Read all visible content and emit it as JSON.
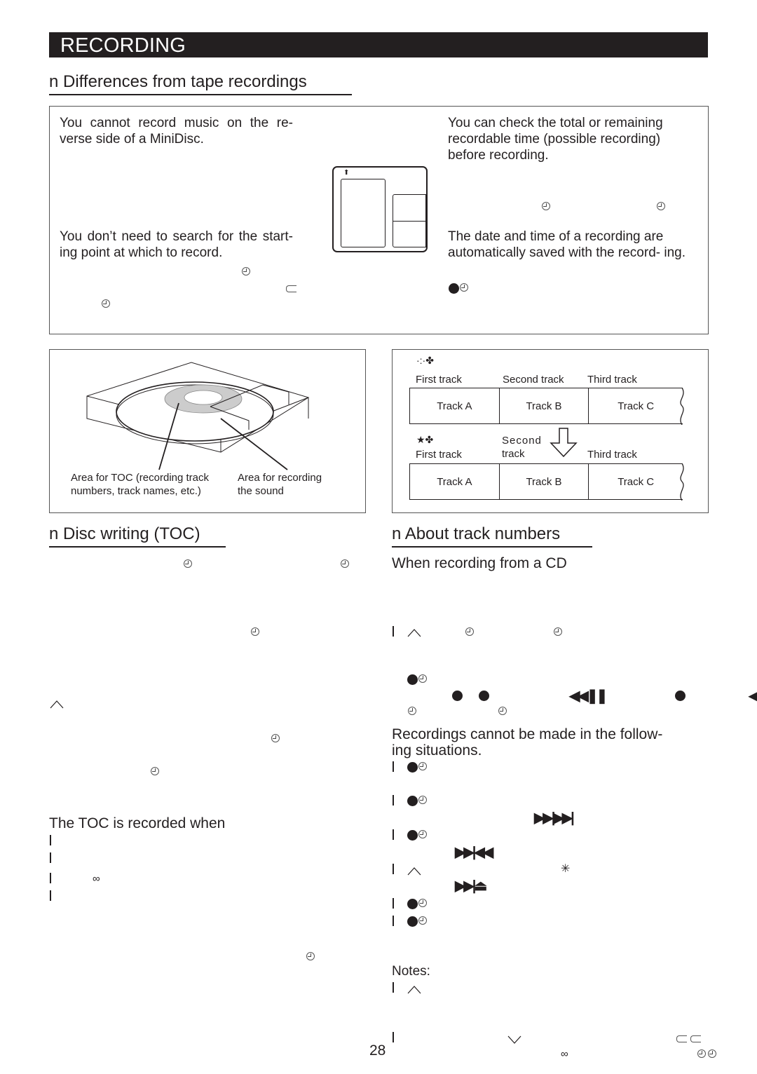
{
  "header": {
    "title": "RECORDING"
  },
  "sections": {
    "differences": {
      "heading": "n  Differences from tape recordings",
      "left": {
        "para1": "You cannot record music on the re- verse side of a MiniDisc.",
        "para2": "You don’t need to search for the start- ing point at which to record."
      },
      "right": {
        "para1": "You can check the total or remaining recordable time (possible recording) before recording.",
        "para2": "The date and time of a recording are automatically saved with the record- ing."
      }
    },
    "disc_diagram": {
      "label_toc": "Area for TOC (recording track numbers, track names, etc.)",
      "label_toc_line1": "Area for TOC (recording track",
      "label_toc_line2": "numbers, track names, etc.)",
      "label_sound_line1": "Area  for  recording",
      "label_sound_line2": "the sound"
    },
    "track_diagram": {
      "before": {
        "symbol": "·:·✤",
        "headers": [
          "First track",
          "Second track",
          "Third track"
        ],
        "cells": [
          "Track A",
          "Track B",
          "Track C"
        ]
      },
      "after": {
        "symbol": "★✤",
        "headers": [
          "First track",
          "Second",
          "track",
          "Third track"
        ],
        "cells": [
          "Track A",
          "Track B",
          "Track C"
        ]
      }
    },
    "toc": {
      "heading": "n  Disc writing (TOC)",
      "sub": "The TOC is recorded when"
    },
    "track_numbers": {
      "heading": "n  About track numbers",
      "sub1": "When recording from a CD",
      "sub2_line1": "Recordings cannot be made in the follow-",
      "sub2_line2": "ing situations.",
      "notes": "Notes:"
    }
  },
  "glyphs": {
    "skip_back_pause": "◀◀❚❚",
    "skip_fwd_skip_fwd": "▶▶|▶▶|",
    "skip_fwd_skip_back": "▶▶|◀◀",
    "skip_fwd_eject": "▶▶|⏏",
    "asterisk": "✳",
    "ring": "∞",
    "caret_up": "^",
    "caret_down": "∨",
    "return": "⊂",
    "bullet": "l",
    "left_tri": "◀"
  },
  "footer": {
    "page_number": "28"
  }
}
